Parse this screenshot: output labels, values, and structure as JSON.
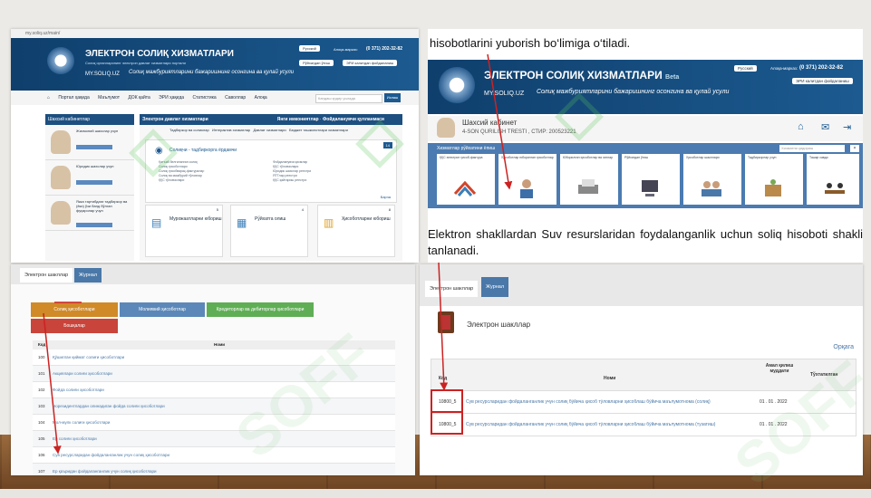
{
  "panel1": {
    "url": "my.soliq.uz/main/",
    "title": "ЭЛЕКТРОН СОЛИҚ ХИЗМАТЛАРИ",
    "subtitle": "Солиқ органларининг электрон давлат хизматлари портали",
    "site": "MY.SOLIQ.UZ",
    "slogan": "Солиқ мажбуриятларини бажаришнинг  осонгина ва қулай усули",
    "lang": "Русский",
    "phone": "(0 371) 202-32-82",
    "phone_label": "Алоқа-марказ:",
    "btn_guide": "Рўйхатдан ўтиш",
    "btn_ecp": "ЭРИ калитдан фойдаланиш",
    "nav": [
      "Портал ҳақида",
      "Маълумот",
      "ДОК қайта",
      "ЭРИ ҳақида",
      "Статистика",
      "Саволлар",
      "Алоқа"
    ],
    "search_placeholder": "Кандаш қидир ушгада",
    "search_btn": "Излаш",
    "cabinet_title": "Шахсий кабинетлар",
    "cabinets": [
      "Жисмоний шахслар учун",
      "Юридик шахслар учун",
      "Якка тартибдаги тадбиркор ва (ёки) ўзи банд бўлган фуқаролар учун"
    ],
    "services_title": "Электрон давлат хизматлари",
    "services_count": "93",
    "services_right": "Янги имкониятлар",
    "services_right_count": "38",
    "services_right2": "Фойдаланувчи қулланмаси",
    "tabs": [
      "Тадбиркор ва соликлар",
      "Интерактив хизматлар",
      "Давлат хизматлари",
      "Бюджет ташкилотлари хизматлари"
    ],
    "box_title": "Солиқчи - тадбиркорга ёрдамчи",
    "box_count": "14",
    "box_list_a": [
      "Қатъий белгиланган солиқ",
      "Солиқ ҳисоботлари",
      "Солиқ ҳисобварақ-фактуралар",
      "Солиқ ва мажбурий тўловлар",
      "ҚҚС тўловчилари"
    ],
    "box_list_b": [
      "Фойдаланувчи қисмлар",
      "ҚҚС тўловчилари",
      "Юридик шахслар реестри",
      "ЯТТлар реестри",
      "ҚҚС қайтариш реестри"
    ],
    "box_more": "Барча",
    "cards": [
      "Мурожаатларни юбориш",
      "Рўйхатга олиш",
      "Ҳисоботларни юбориш"
    ],
    "cards_counts": [
      "5",
      "4",
      "8"
    ]
  },
  "panel2": {
    "caption_top": "hisobotlarini yuborish bo‘limiga o‘tiladi.",
    "title": "ЭЛЕКТРОН СОЛИҚ ХИЗМАТЛАРИ",
    "beta": "Beta",
    "site": "MY.SOLIQ.UZ",
    "slogan": "Солиқ мажбуриятларини бажаришнинг  осонгина ва қулай усули",
    "lang": "Русский",
    "phone_label": "Алоқа-марказ:",
    "phone": "(0 371) 202-32-82",
    "btn_ecp": "ЭРИ калитдан фойдаланиш",
    "cabinet_title": "Шахсий кабинет",
    "cabinet_sub": "4-SON QURILISH TRESTI , СТИР: 200523221",
    "services_bar": "Хизматлар рўйхатини ёпиш",
    "search_placeholder": "Хизматни қидириш",
    "close_x": "×",
    "tiles": [
      "ҚҚС электрон ҳисоб-фактура",
      "Ҳисоботлар юборилган ҳисоботлар",
      "Юборилган ҳисоботлар ва хатлар",
      "Рўйхатдан ўтиш",
      "Ҳисоботлар шакллари",
      "Тадбиркорлар учун",
      "Ташқи савдо"
    ],
    "paragraph": "Elektron shakllardan Suv resurslaridan foydalanganlik uchun soliq hisoboti shakli tanlanadi."
  },
  "panel3": {
    "tabs": [
      "Электрон шакллар",
      "Журнал"
    ],
    "categories": [
      "Солиқ ҳисоботлари",
      "Молиявий ҳисоботлар",
      "Кредиторлар ва дебиторлар ҳисоботлари",
      "Бошқалар"
    ],
    "col_code": "Код",
    "col_name": "Номи",
    "rows": [
      {
        "code": "100",
        "name": "Қўшилган қиймат солиғи ҳисоботлари"
      },
      {
        "code": "101",
        "name": "Акциялари солиғи ҳисоботлари"
      },
      {
        "code": "102",
        "name": "Фойда солиғи ҳисоботлари"
      },
      {
        "code": "103",
        "name": "Норезидентлардан олинадиган фойда солиғи ҳисоботлари"
      },
      {
        "code": "104",
        "name": "Мол-мулк солиғи ҳисоботлари"
      },
      {
        "code": "105",
        "name": "Ер солиғи ҳисоботлари"
      },
      {
        "code": "106",
        "name": "Сув ресурсларидан фойдаланганлик учун солиқ ҳисоботлари"
      },
      {
        "code": "107",
        "name": "Ер қаъридан фойдаланганлик учун солиқ ҳисоботлари"
      }
    ]
  },
  "panel4": {
    "tabs": [
      "Электрон шакллар",
      "Журнал"
    ],
    "title": "Электрон шакллар",
    "back": "Орқага",
    "col_code": "Код",
    "col_name": "Номи",
    "col_period": "Амал қилиш муддати",
    "col_end": "Тўхтатилган",
    "rows": [
      {
        "code": "10800_5",
        "name": "Сув ресурсларидан фойдаланганлик учун солиқ бўйича ҳисоб тўловларни ҳисоблаш бўйича маълумотнома (солиқ)",
        "date": "01 . 01 . 2022"
      },
      {
        "code": "10800_5",
        "name": "Сув ресурсларидан фойдаланганлик учун солиқ бўйича ҳисоб тўловларни ҳисоблаш бўйича маълумотнома (тузатиш)",
        "date": "01 . 01 . 2022"
      }
    ]
  },
  "watermark": "SOFF",
  "colors": {
    "header": "#1c5a90",
    "accent_red": "#c22",
    "tile_bar": "#4b7bb0"
  }
}
